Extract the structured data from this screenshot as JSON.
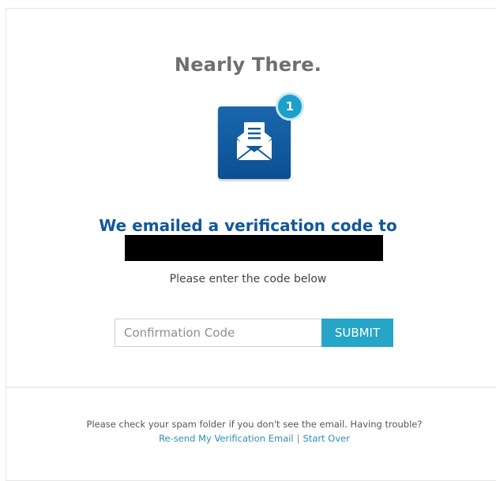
{
  "header": {
    "title": "Nearly There."
  },
  "icon": {
    "name": "envelope-letter-icon",
    "badge_count": "1",
    "colors": {
      "box": "#0f5a9e",
      "badge": "#1e9fca"
    }
  },
  "message": {
    "headline": "We emailed a verification code to",
    "instruction": "Please enter the code below"
  },
  "form": {
    "code_placeholder": "Confirmation Code",
    "code_value": "",
    "submit_label": "SUBMIT"
  },
  "footer": {
    "help_text": "Please check your spam folder if you don't see the email. Having trouble?",
    "resend_link": "Re-send My Verification Email",
    "separator": "|",
    "start_over_link": "Start Over"
  }
}
